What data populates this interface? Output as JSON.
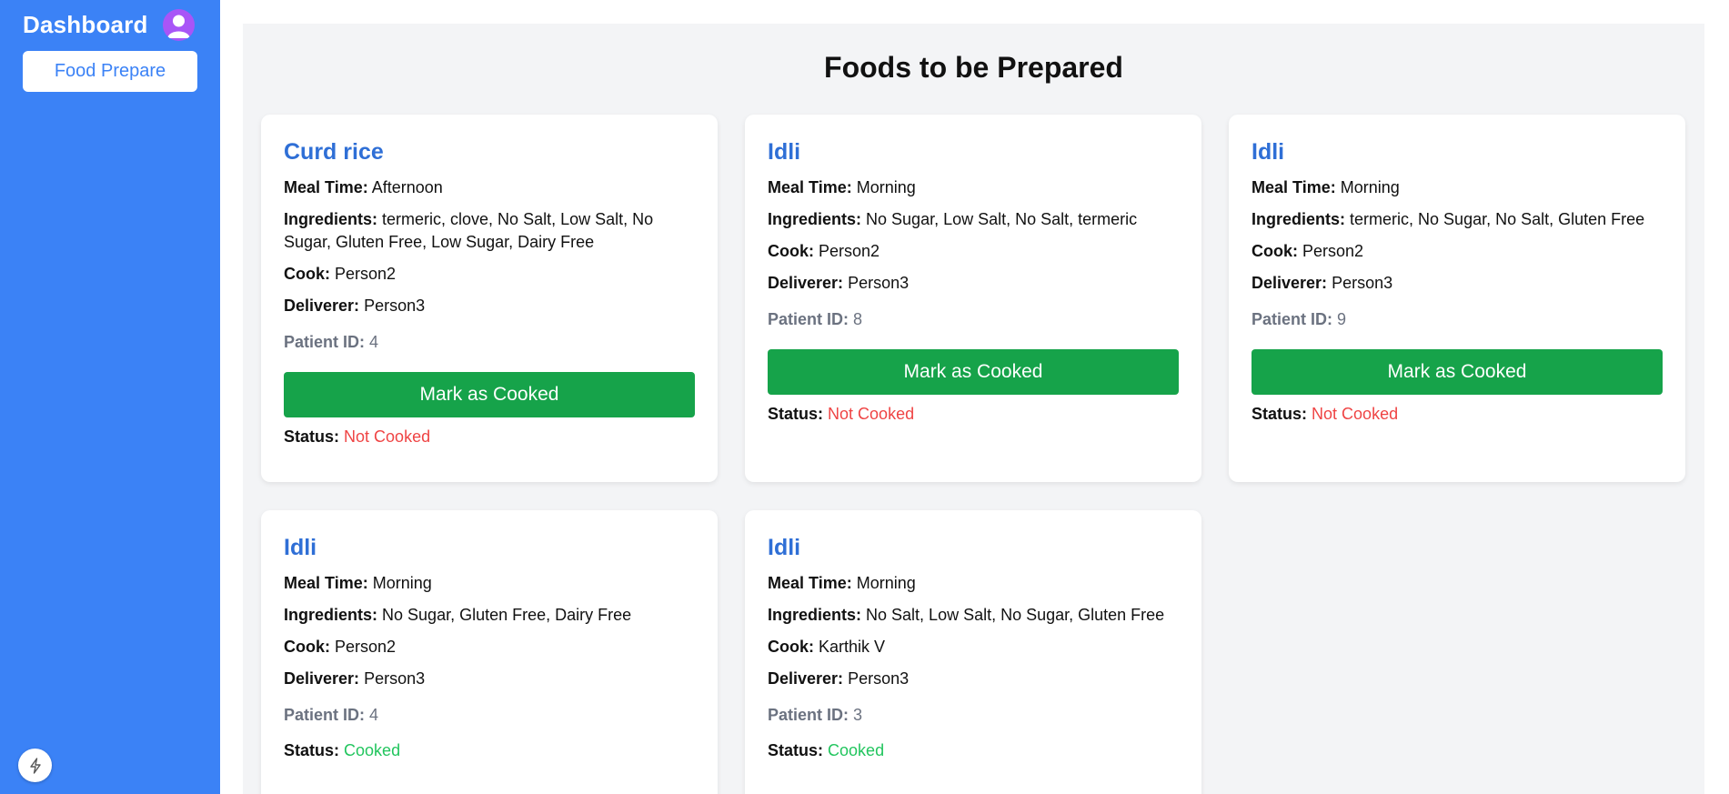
{
  "sidebar": {
    "title": "Dashboard",
    "avatar_icon": "user-avatar-icon",
    "nav_button_label": "Food Prepare",
    "bolt_icon": "lightning-bolt-icon",
    "colors": {
      "background": "#3b82f6",
      "avatar": "#a855f7"
    }
  },
  "main": {
    "title": "Foods to be Prepared"
  },
  "labels": {
    "meal_time": "Meal Time:",
    "ingredients": "Ingredients:",
    "cook": "Cook:",
    "deliverer": "Deliverer:",
    "patient_id": "Patient ID:",
    "status": "Status:",
    "mark_cooked": "Mark as Cooked"
  },
  "cards": [
    {
      "name": "Curd rice",
      "meal_time": "Afternoon",
      "ingredients": "termeric, clove, No Salt, Low Salt, No Sugar, Gluten Free, Low Sugar, Dairy Free",
      "cook": "Person2",
      "deliverer": "Person3",
      "patient_id": "4",
      "status": "Not Cooked"
    },
    {
      "name": "Idli",
      "meal_time": "Morning",
      "ingredients": "No Sugar, Low Salt, No Salt, termeric",
      "cook": "Person2",
      "deliverer": "Person3",
      "patient_id": "8",
      "status": "Not Cooked"
    },
    {
      "name": "Idli",
      "meal_time": "Morning",
      "ingredients": "termeric, No Sugar, No Salt, Gluten Free",
      "cook": "Person2",
      "deliverer": "Person3",
      "patient_id": "9",
      "status": "Not Cooked"
    },
    {
      "name": "Idli",
      "meal_time": "Morning",
      "ingredients": "No Sugar, Gluten Free, Dairy Free",
      "cook": "Person2",
      "deliverer": "Person3",
      "patient_id": "4",
      "status": "Cooked"
    },
    {
      "name": "Idli",
      "meal_time": "Morning",
      "ingredients": "No Salt, Low Salt, No Sugar, Gluten Free",
      "cook": "Karthik V",
      "deliverer": "Person3",
      "patient_id": "3",
      "status": "Cooked"
    }
  ],
  "colors": {
    "accent": "#3b82f6",
    "cook_button": "#16a34a",
    "not_cooked": "#ef4444",
    "cooked": "#22c55e",
    "main_bg": "#f3f4f6"
  }
}
